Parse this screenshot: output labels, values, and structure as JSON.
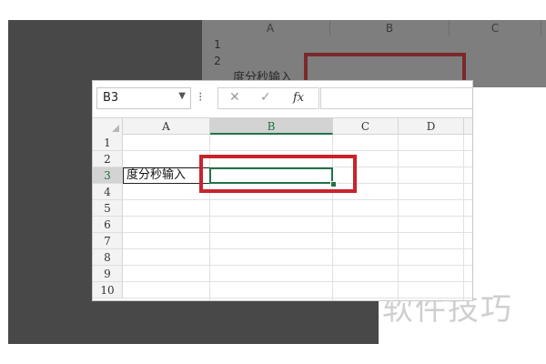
{
  "background_sheet": {
    "col_headers": [
      "A",
      "B",
      "C"
    ],
    "row_numbers": [
      "1",
      "2"
    ],
    "cell_text": "度分秒输入"
  },
  "excel": {
    "name_box": {
      "value": "B3",
      "dropdown_icon": "chevron-down-icon"
    },
    "formula_bar": {
      "cancel_icon": "close-icon",
      "enter_icon": "check-icon",
      "function_label": "fx",
      "formula_value": ""
    },
    "columns": [
      "A",
      "B",
      "C",
      "D"
    ],
    "rows": [
      "1",
      "2",
      "3",
      "4",
      "5",
      "6",
      "7",
      "8",
      "9",
      "10"
    ],
    "selected_column": "B",
    "selected_row": "3",
    "cells": {
      "A3": "度分秒输入",
      "B3": ""
    }
  },
  "watermark": "软件技巧",
  "colors": {
    "excel_green": "#217346",
    "highlight_red": "#c8232b"
  }
}
